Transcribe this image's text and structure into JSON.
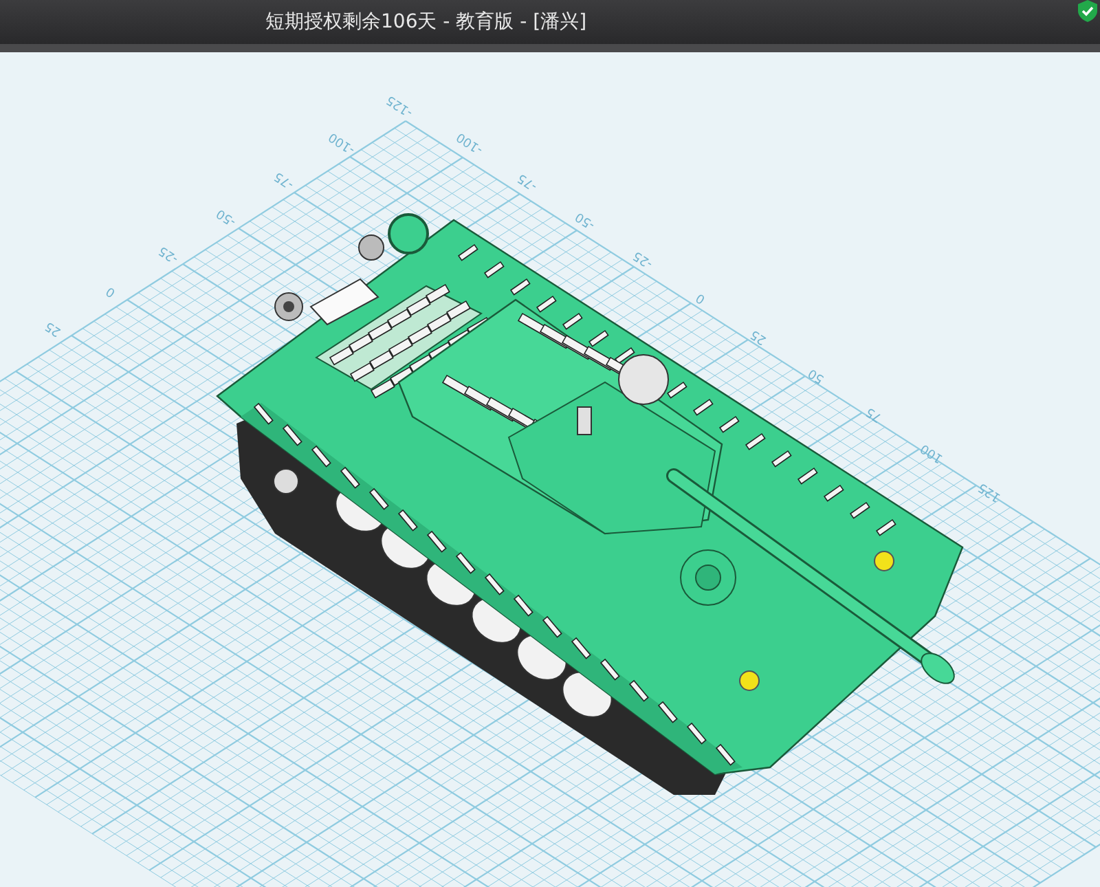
{
  "window": {
    "title": "短期授权剩余106天 - 教育版 - [潘兴]"
  },
  "grid_labels": {
    "outer_edge": [
      "25",
      "0",
      "-25",
      "-50",
      "-75",
      "-100",
      "-125"
    ],
    "inner_edge": [
      "-100",
      "-75",
      "-50",
      "-25",
      "0",
      "25",
      "50",
      "75",
      "100",
      "125"
    ]
  }
}
